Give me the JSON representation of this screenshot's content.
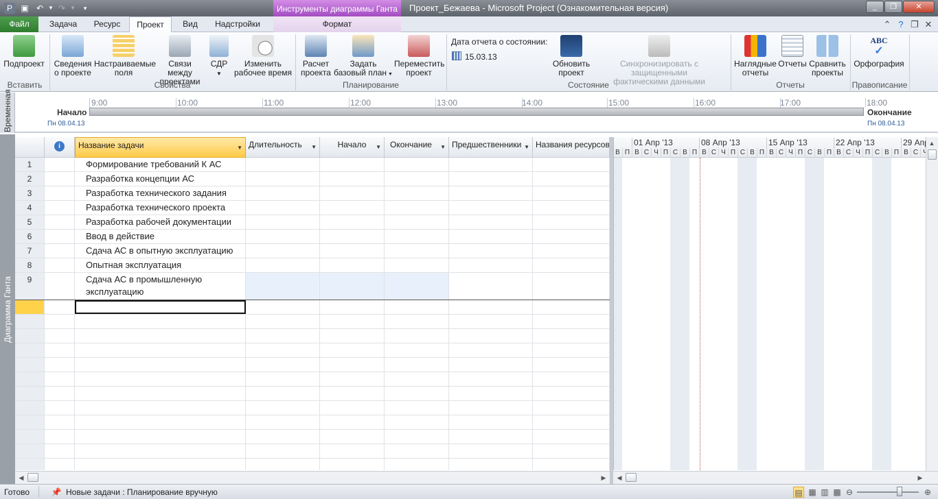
{
  "window": {
    "title": "Проект_Бежаева  -  Microsoft Project (Ознакомительная версия)",
    "context_title": "Инструменты диаграммы Ганта",
    "quick_access": [
      "save-icon",
      "undo-icon",
      "dropdown-icon",
      "redo-icon",
      "dropdown-icon",
      "customize-icon"
    ]
  },
  "tabs": {
    "file": "Файл",
    "task": "Задача",
    "resource": "Ресурс",
    "project": "Проект",
    "view": "Вид",
    "addins": "Надстройки",
    "format": "Формат",
    "active": "Проект"
  },
  "ribbon": {
    "insert": {
      "subproject": "Подпроект",
      "group": "Вставить"
    },
    "properties": {
      "project_info": [
        "Сведения",
        "о проекте"
      ],
      "custom_fields": [
        "Настраиваемые",
        "поля"
      ],
      "links": [
        "Связи между",
        "проектами"
      ],
      "wbs": "СДР",
      "change_time": [
        "Изменить",
        "рабочее время"
      ],
      "group": "Свойства"
    },
    "schedule": {
      "calc": [
        "Расчет",
        "проекта"
      ],
      "baseline": [
        "Задать",
        "базовый план"
      ],
      "move": [
        "Переместить",
        "проект"
      ],
      "group": "Планирование"
    },
    "status": {
      "status_date_label": "Дата отчета о состоянии:",
      "status_date": "15.03.13",
      "update": [
        "Обновить",
        "проект"
      ],
      "sync": [
        "Синхронизировать с защищенными",
        "фактическими данными"
      ],
      "group": "Состояние"
    },
    "reports": {
      "visual": [
        "Наглядные",
        "отчеты"
      ],
      "reports": "Отчеты",
      "compare": [
        "Сравнить",
        "проекты"
      ],
      "group": "Отчеты"
    },
    "proofing": {
      "spelling": "Орфография",
      "group": "Правописание"
    }
  },
  "timeline": {
    "side_label": "Временная",
    "start_label": "Начало",
    "start_date": "Пн 08.04.13",
    "end_label": "Окончание",
    "end_date": "Пн 08.04.13",
    "times": [
      "9:00",
      "10:00",
      "11:00",
      "12:00",
      "13:00",
      "14:00",
      "15:00",
      "16:00",
      "17:00",
      "18:00"
    ]
  },
  "view_label": "Диаграмма Ганта",
  "table": {
    "headers": {
      "info": "i",
      "name": "Название задачи",
      "duration": "Длительность",
      "start": "Начало",
      "finish": "Окончание",
      "predecessors": "Предшественники",
      "resources": "Названия ресурсов"
    },
    "tasks": [
      {
        "id": "1",
        "name": "Формирование требований К АС"
      },
      {
        "id": "2",
        "name": "Разработка концепции АС"
      },
      {
        "id": "3",
        "name": "Разработка технического задания"
      },
      {
        "id": "4",
        "name": "Разработка технического проекта"
      },
      {
        "id": "5",
        "name": "Разработка рабочей документации"
      },
      {
        "id": "6",
        "name": "Ввод в действие"
      },
      {
        "id": "7",
        "name": "Сдача АС в опытную эксплуатацию"
      },
      {
        "id": "8",
        "name": "Опытная эксплуатация"
      },
      {
        "id": "9",
        "name": "Сдача АС в промышленную",
        "name2": "эксплуатацию"
      }
    ]
  },
  "gantt": {
    "weeks": [
      "01 Апр '13",
      "08 Апр '13",
      "15 Апр '13",
      "22 Апр '13",
      "29 Апр '13"
    ],
    "days": [
      "В",
      "П",
      "В",
      "С",
      "Ч",
      "П",
      "С"
    ]
  },
  "statusbar": {
    "ready": "Готово",
    "new_tasks": "Новые задачи : Планирование вручную"
  },
  "colors": {
    "file_tab": "#2f7c2f",
    "context_tab": "#a24cc2",
    "active_cell": "#ffd24a",
    "weekend": "#e7ecf3",
    "today_line": "#c24a4a"
  }
}
